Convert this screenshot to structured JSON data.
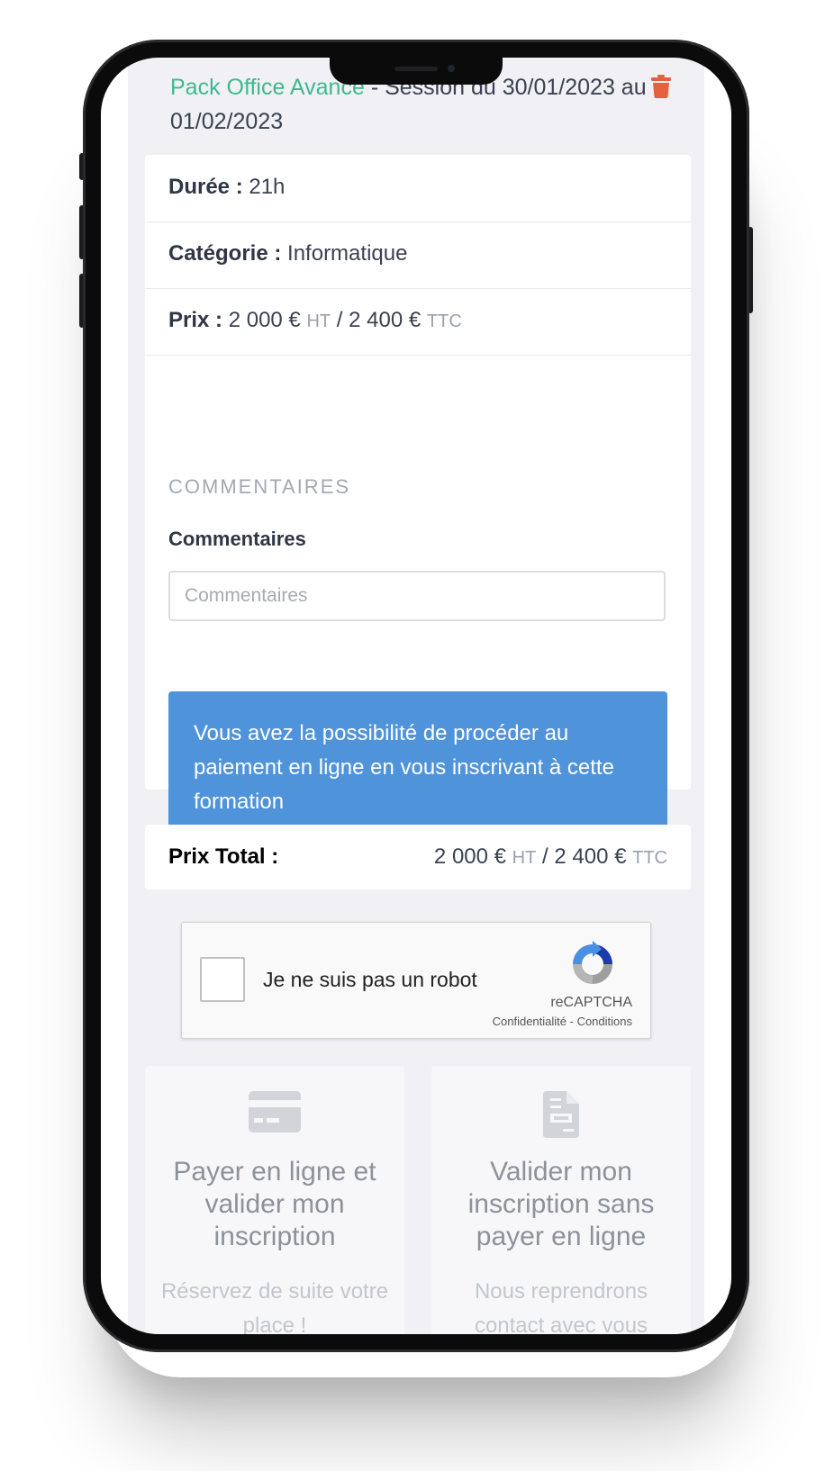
{
  "order": {
    "course_link": "Pack Office Avance",
    "session_text": " - Session du 30/01/2023 au 01/02/2023",
    "delete_icon": "trash-icon"
  },
  "details": {
    "duration_label": "Durée : ",
    "duration_value": "21h",
    "category_label": "Catégorie : ",
    "category_value": "Informatique",
    "price_label": "Prix : ",
    "price_ht": "2 000 €",
    "ht": "HT",
    "separator": " / ",
    "price_ttc": "2 400 €",
    "ttc": "TTC"
  },
  "comments": {
    "section_title": "COMMENTAIRES",
    "field_label": "Commentaires",
    "placeholder": "Commentaires",
    "value": ""
  },
  "alert": {
    "text": "Vous avez la possibilité de procéder au paiement en ligne en vous inscrivant à cette formation"
  },
  "total": {
    "label": "Prix Total :",
    "price_ht": "2 000 €",
    "ht": "HT",
    "separator": " / ",
    "price_ttc": "2 400 €",
    "ttc": "TTC"
  },
  "recaptcha": {
    "label": "Je ne suis pas un robot",
    "brand": "reCAPTCHA",
    "links": "Confidentialité - Conditions"
  },
  "options": [
    {
      "icon": "credit-card-icon",
      "title": "Payer en ligne et valider mon inscription",
      "subtitle": "Réservez de suite votre place !"
    },
    {
      "icon": "document-icon",
      "title": "Valider mon inscription sans payer en ligne",
      "subtitle": "Nous reprendrons contact avec vous"
    }
  ],
  "colors": {
    "accent_green": "#3fb98d",
    "alert_blue": "#4f93db",
    "delete_red": "#e5603f"
  }
}
